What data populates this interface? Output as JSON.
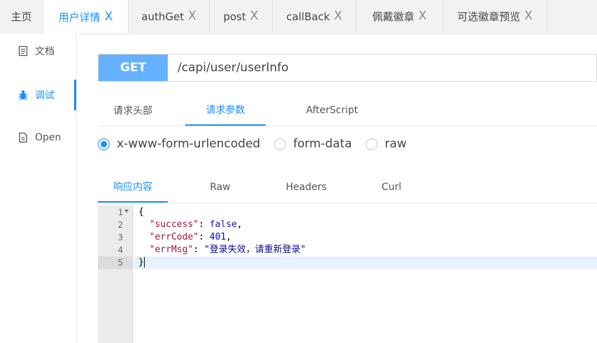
{
  "tabs": [
    {
      "label": "主页",
      "closable": false,
      "active": false
    },
    {
      "label": "用户详情",
      "closable": true,
      "active": true
    },
    {
      "label": "authGet",
      "closable": true,
      "active": false
    },
    {
      "label": "post",
      "closable": true,
      "active": false
    },
    {
      "label": "callBack",
      "closable": true,
      "active": false
    },
    {
      "label": "佩戴徽章",
      "closable": true,
      "active": false
    },
    {
      "label": "可选徽章预览",
      "closable": true,
      "active": false
    }
  ],
  "close_glyph": "X",
  "sidebar": {
    "items": [
      {
        "label": "文档",
        "icon": "document-icon",
        "active": false
      },
      {
        "label": "调试",
        "icon": "bug-icon",
        "active": true
      },
      {
        "label": "Open",
        "icon": "file-icon",
        "active": false
      }
    ]
  },
  "request": {
    "method": "GET",
    "url": "/capi/user/userInfo"
  },
  "request_tabs": [
    {
      "label": "请求头部",
      "active": false
    },
    {
      "label": "请求参数",
      "active": true
    },
    {
      "label": "AfterScript",
      "active": false
    }
  ],
  "body_types": [
    {
      "label": "x-www-form-urlencoded",
      "selected": true
    },
    {
      "label": "form-data",
      "selected": false
    },
    {
      "label": "raw",
      "selected": false
    }
  ],
  "response_tabs": [
    {
      "label": "响应内容",
      "active": true
    },
    {
      "label": "Raw",
      "active": false
    },
    {
      "label": "Headers",
      "active": false
    },
    {
      "label": "Curl",
      "active": false
    }
  ],
  "response": {
    "line_numbers": [
      "1",
      "2",
      "3",
      "4",
      "5"
    ],
    "open_brace": "{",
    "close_brace": "}",
    "fields": [
      {
        "key": "\"success\"",
        "value": "false"
      },
      {
        "key": "\"errCode\"",
        "value": "401"
      },
      {
        "key": "\"errMsg\"",
        "value": "\"登录失效，请重新登录\""
      }
    ]
  },
  "colors": {
    "accent": "#1890ff",
    "method_bg": "#66b1ff",
    "json_key": "#a1163d",
    "json_string": "#0a0a8c",
    "json_number": "#0000cc"
  }
}
